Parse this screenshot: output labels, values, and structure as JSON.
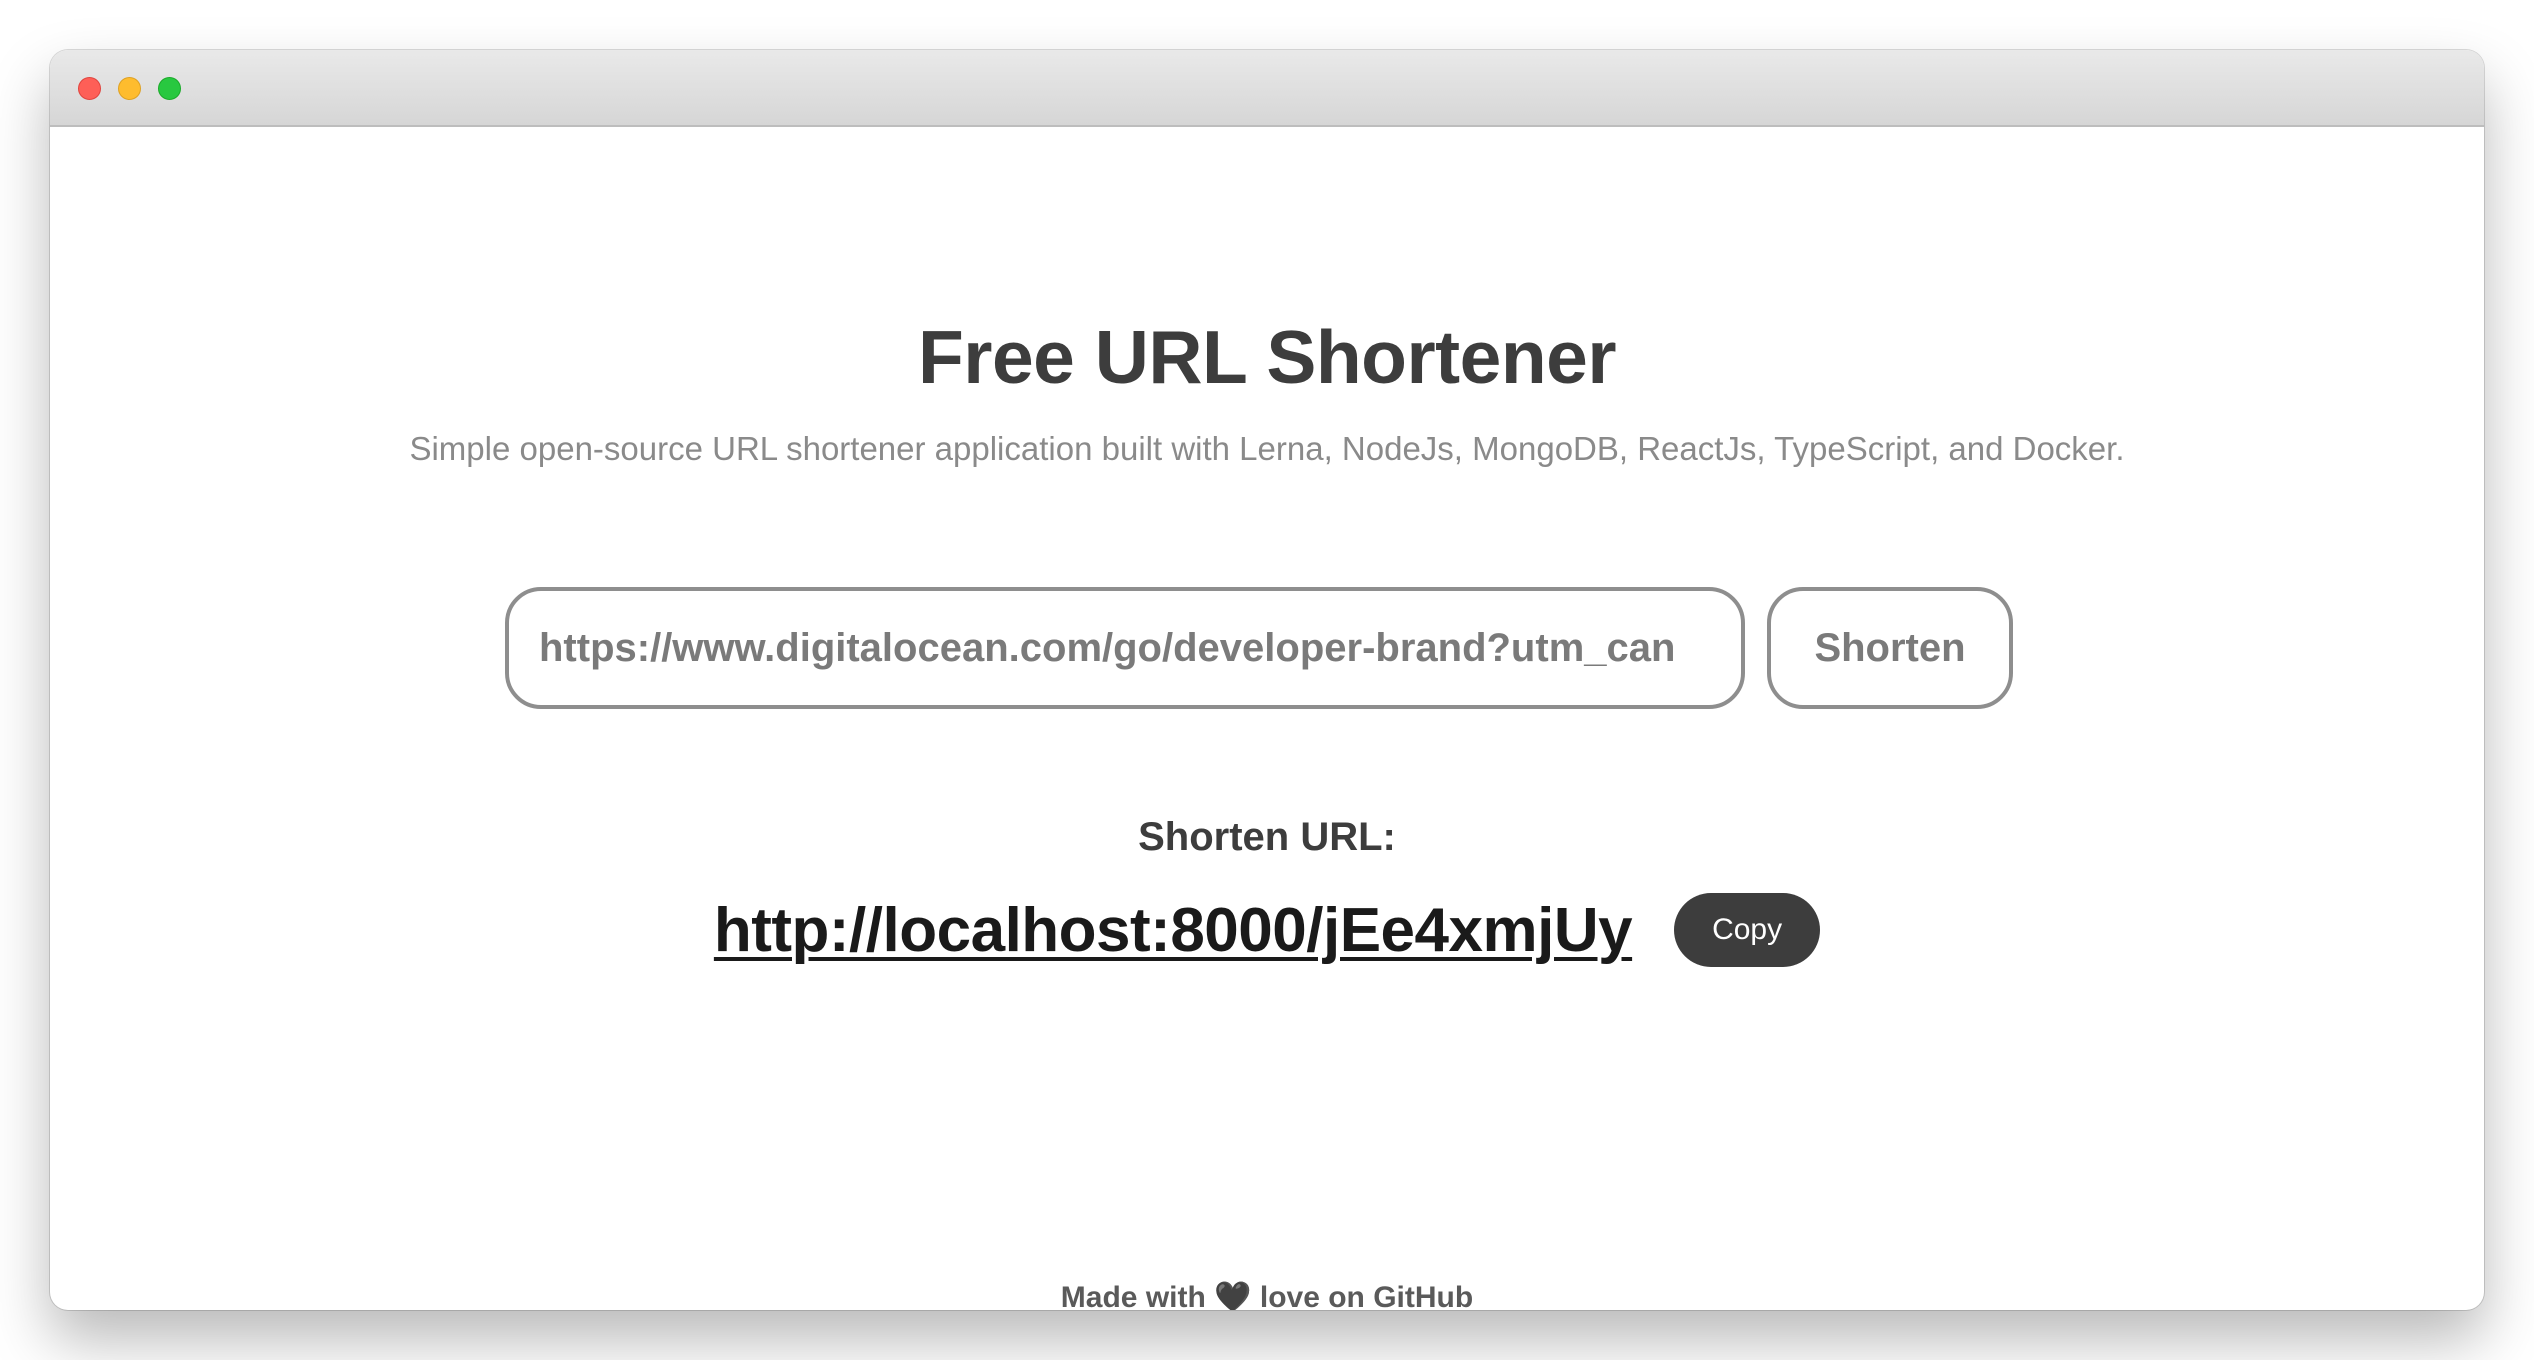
{
  "window": {
    "traffic_lights": {
      "close_color": "#fe5f57",
      "minimize_color": "#febc2e",
      "zoom_color": "#28c840"
    }
  },
  "header": {
    "title": "Free URL Shortener",
    "subtitle": "Simple open-source URL shortener application built with Lerna, NodeJs, MongoDB, ReactJs, TypeScript, and Docker."
  },
  "form": {
    "url_value": "https://www.digitalocean.com/go/developer-brand?utm_can",
    "shorten_label": "Shorten"
  },
  "result": {
    "label": "Shorten URL:",
    "short_url": "http://localhost:8000/jEe4xmjUy",
    "copy_label": "Copy"
  },
  "footer": {
    "prefix": "Made with",
    "heart_icon": "heart-icon",
    "heart_glyph": "🖤",
    "suffix": "love on GitHub"
  }
}
